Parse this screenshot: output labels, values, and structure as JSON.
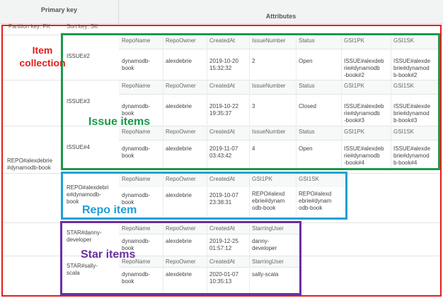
{
  "table": {
    "primary_key_header": "Primary key",
    "attributes_header": "Attributes",
    "partition_key_label": "Partition key: PK",
    "sort_key_label": "Sort key: SK"
  },
  "partition": "REPO#alexdebrie\n#dynamodb-book",
  "issues": [
    {
      "sk": "ISSUE#2",
      "h": [
        "RepoName",
        "RepoOwner",
        "CreatedAt",
        "IssueNumber",
        "Status",
        "GSI1PK",
        "GSI1SK"
      ],
      "v": [
        "dynamodb-\nbook",
        "alexdebrie",
        "2019-10-20\n15:32:32",
        "2",
        "Open",
        "ISSUE#alexdeb\nrie#dynamodb\n-book#2",
        "ISSUE#alexde\nbrie#dynamod\nb-book#2"
      ]
    },
    {
      "sk": "ISSUE#3",
      "h": [
        "RepoName",
        "RepoOwner",
        "CreatedAt",
        "IssueNumber",
        "Status",
        "GSI1PK",
        "GSI1SK"
      ],
      "v": [
        "dynamodb-\nbook",
        "alexdebrie",
        "2019-10-22\n19:35:37",
        "3",
        "Closed",
        "ISSUE#alexdeb\nrie#dynamodb\n-book#3",
        "ISSUE#alexde\nbrie#dynamod\nb-book#3"
      ]
    },
    {
      "sk": "ISSUE#4",
      "h": [
        "RepoName",
        "RepoOwner",
        "CreatedAt",
        "IssueNumber",
        "Status",
        "GSI1PK",
        "GSI1SK"
      ],
      "v": [
        "dynamodb-\nbook",
        "alexdebrie",
        "2019-11-07\n03:43:42",
        "4",
        "Open",
        "ISSUE#alexdeb\nrie#dynamodb\n-book#4",
        "ISSUE#alexde\nbrie#dynamod\nb-book#4"
      ]
    }
  ],
  "repo": {
    "sk": "REPO#alexdebri\ne#dynamodb-\nbook",
    "h": [
      "RepoName",
      "RepoOwner",
      "CreatedAt",
      "GSI1PK",
      "GSI1SK"
    ],
    "v": [
      "dynamodb-\nbook",
      "alexdebrie",
      "2019-10-07\n23:38:31",
      "REPO#alexd\nebrie#dynam\nodb-book",
      "REPO#alexd\nebrie#dynam\nodb-book"
    ]
  },
  "stars": [
    {
      "sk": "STAR#danny-\ndeveloper",
      "h": [
        "RepoName",
        "RepoOwner",
        "CreatedAt",
        "StarringUser"
      ],
      "v": [
        "dynamodb-\nbook",
        "alexdebrie",
        "2019-12-25\n01:57:12",
        "danny-\ndeveloper"
      ]
    },
    {
      "sk": "STAR#sally-\nscala",
      "h": [
        "RepoName",
        "RepoOwner",
        "CreatedAt",
        "StarringUser"
      ],
      "v": [
        "dynamodb-\nbook",
        "alexdebrie",
        "2020-01-07\n10:35:13",
        "sally-scala"
      ]
    }
  ],
  "annotations": {
    "item_collection": "Item\ncollection",
    "issue_items": "Issue items",
    "repo_item": "Repo item",
    "star_items": "Star items"
  },
  "colors": {
    "item_collection": "#e0201b",
    "issue_items": "#1a9a4a",
    "repo_item": "#1ba0d8",
    "star_items": "#6b2fa0"
  }
}
